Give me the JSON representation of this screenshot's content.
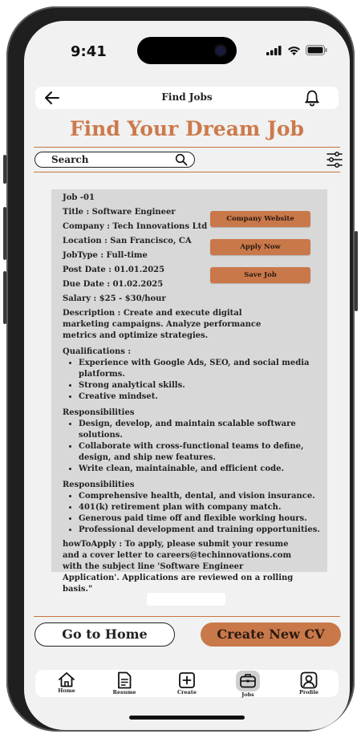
{
  "status": {
    "time": "9:41"
  },
  "header": {
    "title": "Find Jobs"
  },
  "headline": "Find Your Dream Job",
  "search": {
    "label": "Search"
  },
  "job": {
    "id": "Job -01",
    "title": "Title : Software Engineer",
    "company": "Company : Tech Innovations Ltd",
    "location": "Location : San Francisco, CA",
    "job_type": "JobType : Full-time",
    "post_date": "Post Date : 01.01.2025",
    "due_date": "Due Date : 01.02.2025",
    "salary": "Salary : $25 - $30/hour",
    "description": "Description : Create and execute digital marketing campaigns. Analyze performance metrics and optimize strategies.",
    "qualifications_label": "Qualifications :",
    "qualifications": [
      "Experience with Google Ads, SEO, and social media platforms.",
      "Strong analytical skills.",
      "Creative mindset."
    ],
    "responsibilities_label": "Responsibilities",
    "responsibilities": [
      "Design, develop, and maintain scalable software solutions.",
      "Collaborate with cross-functional teams to define, design, and ship new features.",
      "Write clean, maintainable, and efficient code."
    ],
    "benefits_label": "Responsibilities",
    "benefits": [
      "Comprehensive health, dental, and vision insurance.",
      "401(k) retirement plan with company match.",
      "Generous paid time off and flexible working hours.",
      "Professional development and training opportunities."
    ],
    "how_to_apply": "howToApply : To apply, please submit your resume and a cover letter to careers@techinnovations.com with the subject line 'Software Engineer Application'. Applications are reviewed on a rolling basis.\"",
    "buttons": {
      "website": "Company Website",
      "apply": "Apply Now",
      "save": "Save Job"
    }
  },
  "actions": {
    "home": "Go to Home",
    "create_cv": "Create New CV"
  },
  "nav": {
    "items": [
      {
        "label": "Home",
        "icon": "home-icon"
      },
      {
        "label": "Resume",
        "icon": "resume-icon"
      },
      {
        "label": "Create",
        "icon": "create-icon"
      },
      {
        "label": "Jobs",
        "icon": "jobs-icon",
        "active": true
      },
      {
        "label": "Profile",
        "icon": "profile-icon"
      }
    ]
  },
  "colors": {
    "accent": "#c9784a",
    "headline": "#cc7a4b",
    "card": "#d8d8d8",
    "background": "#f1f1f1"
  }
}
